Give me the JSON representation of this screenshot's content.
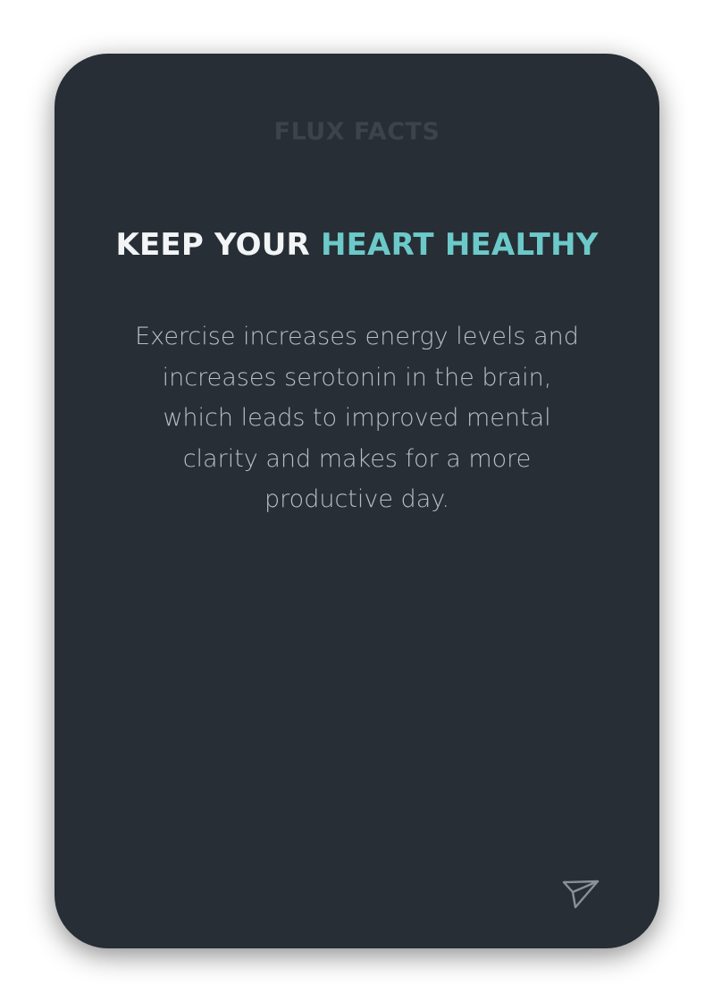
{
  "card": {
    "brand": "FLUX FACTS",
    "headline_plain": "KEEP YOUR",
    "headline_accent": "HEART HEALTHY",
    "body": "Exercise increases energy levels and increases serotonin in the brain, which leads to improved mental clarity and makes for a more productive day."
  },
  "icons": {
    "share": "send-icon"
  },
  "colors": {
    "card_background": "#272e35",
    "accent": "#6cc9c9",
    "headline": "#f2f4f5",
    "brand": "#3a444a",
    "body_text": "#b9bec2"
  }
}
